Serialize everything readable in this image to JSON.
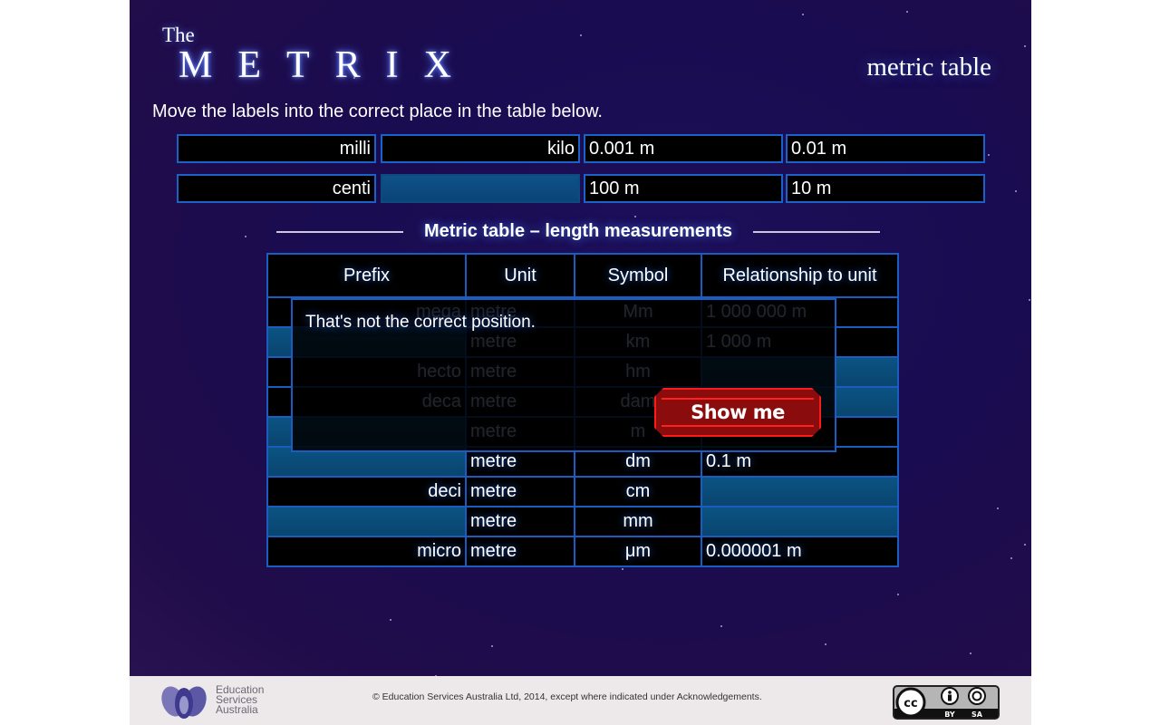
{
  "header": {
    "title_prefix": "The",
    "title": "METRIX",
    "subtitle": "metric table"
  },
  "instruction": "Move the labels into the correct place in the table below.",
  "labels": {
    "row1": [
      "milli",
      "kilo",
      "0.001 m",
      "0.01 m"
    ],
    "row2": [
      "centi",
      "",
      "100 m",
      "10 m"
    ]
  },
  "table": {
    "heading": "Metric table – length measurements",
    "columns": [
      "Prefix",
      "Unit",
      "Symbol",
      "Relationship to unit"
    ],
    "rows": [
      {
        "prefix": "mega",
        "unit": "metre",
        "symbol": "Mm",
        "relationship": "1 000 000 m"
      },
      {
        "prefix": "",
        "unit": "metre",
        "symbol": "km",
        "relationship": "1 000 m"
      },
      {
        "prefix": "hecto",
        "unit": "metre",
        "symbol": "hm",
        "relationship": ""
      },
      {
        "prefix": "deca",
        "unit": "metre",
        "symbol": "dam",
        "relationship": ""
      },
      {
        "prefix": "",
        "unit": "metre",
        "symbol": "m",
        "relationship": "1 m"
      },
      {
        "prefix": "",
        "unit": "metre",
        "symbol": "dm",
        "relationship": "0.1 m"
      },
      {
        "prefix": "deci",
        "unit": "metre",
        "symbol": "cm",
        "relationship": ""
      },
      {
        "prefix": "",
        "unit": "metre",
        "symbol": "mm",
        "relationship": ""
      },
      {
        "prefix": "micro",
        "unit": "metre",
        "symbol": "μm",
        "relationship": "0.000001 m"
      }
    ]
  },
  "feedback": {
    "message": "That's not the correct position.",
    "button_label": "Show me"
  },
  "footer": {
    "org_line1": "Education",
    "org_line2": "Services",
    "org_line3": "Australia",
    "copyright": "© Education Services Australia Ltd, 2014, except where indicated under Acknowledgements.",
    "license_by": "BY",
    "license_sa": "SA",
    "license_cc": "cc"
  },
  "colors": {
    "background": "#1a0c50",
    "cell_border": "#1a5cc0",
    "empty_slot": "#0b4d7f",
    "button_red": "#8a0c0c",
    "button_border": "#ff1a1a"
  }
}
